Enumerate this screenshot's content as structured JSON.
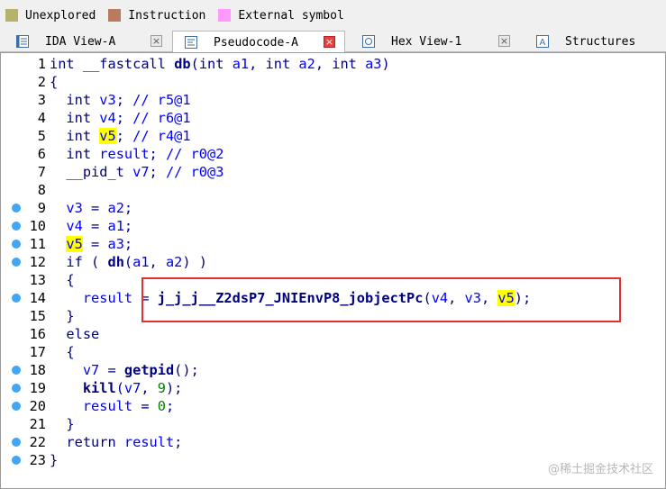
{
  "legend": [
    {
      "label": "Unexplored",
      "color": "#b3b36b"
    },
    {
      "label": "Instruction",
      "color": "#b87b5e"
    },
    {
      "label": "External symbol",
      "color": "#ff99ff"
    }
  ],
  "tabs": [
    {
      "label": "IDA View-A",
      "icon": "ida-view-icon",
      "active": false
    },
    {
      "label": "Pseudocode-A",
      "icon": "pseudocode-icon",
      "active": true
    },
    {
      "label": "Hex View-1",
      "icon": "hex-view-icon",
      "active": false
    },
    {
      "label": "Structures",
      "icon": "structures-icon",
      "active": false
    }
  ],
  "code": [
    {
      "n": "1",
      "bp": false,
      "t": "int __fastcall db(int a1, int a2, int a3)"
    },
    {
      "n": "2",
      "bp": false,
      "t": "{"
    },
    {
      "n": "3",
      "bp": false,
      "t": "  int v3; // r5@1"
    },
    {
      "n": "4",
      "bp": false,
      "t": "  int v4; // r6@1"
    },
    {
      "n": "5",
      "bp": false,
      "t": "  int v5; // r4@1"
    },
    {
      "n": "6",
      "bp": false,
      "t": "  int result; // r0@2"
    },
    {
      "n": "7",
      "bp": false,
      "t": "  __pid_t v7; // r0@3"
    },
    {
      "n": "8",
      "bp": false,
      "t": ""
    },
    {
      "n": "9",
      "bp": true,
      "t": "  v3 = a2;"
    },
    {
      "n": "10",
      "bp": true,
      "t": "  v4 = a1;"
    },
    {
      "n": "11",
      "bp": true,
      "t": "  v5 = a3;"
    },
    {
      "n": "12",
      "bp": true,
      "t": "  if ( dh(a1, a2) )"
    },
    {
      "n": "13",
      "bp": false,
      "t": "  {"
    },
    {
      "n": "14",
      "bp": true,
      "t": "    result = j_j_j__Z2dsP7_JNIEnvP8_jobjectPc(v4, v3, v5);"
    },
    {
      "n": "15",
      "bp": false,
      "t": "  }"
    },
    {
      "n": "16",
      "bp": false,
      "t": "  else"
    },
    {
      "n": "17",
      "bp": false,
      "t": "  {"
    },
    {
      "n": "18",
      "bp": true,
      "t": "    v7 = getpid();"
    },
    {
      "n": "19",
      "bp": true,
      "t": "    kill(v7, 9);"
    },
    {
      "n": "20",
      "bp": true,
      "t": "    result = 0;"
    },
    {
      "n": "21",
      "bp": false,
      "t": "  }"
    },
    {
      "n": "22",
      "bp": true,
      "t": "  return result;"
    },
    {
      "n": "23",
      "bp": true,
      "t": "}"
    }
  ],
  "highlight_word": "v5",
  "watermark": "@稀土掘金技术社区",
  "colors": {
    "breakpoint": "#42a5f5",
    "highlight": "#ffff00",
    "annotation_box": "#e03030"
  }
}
